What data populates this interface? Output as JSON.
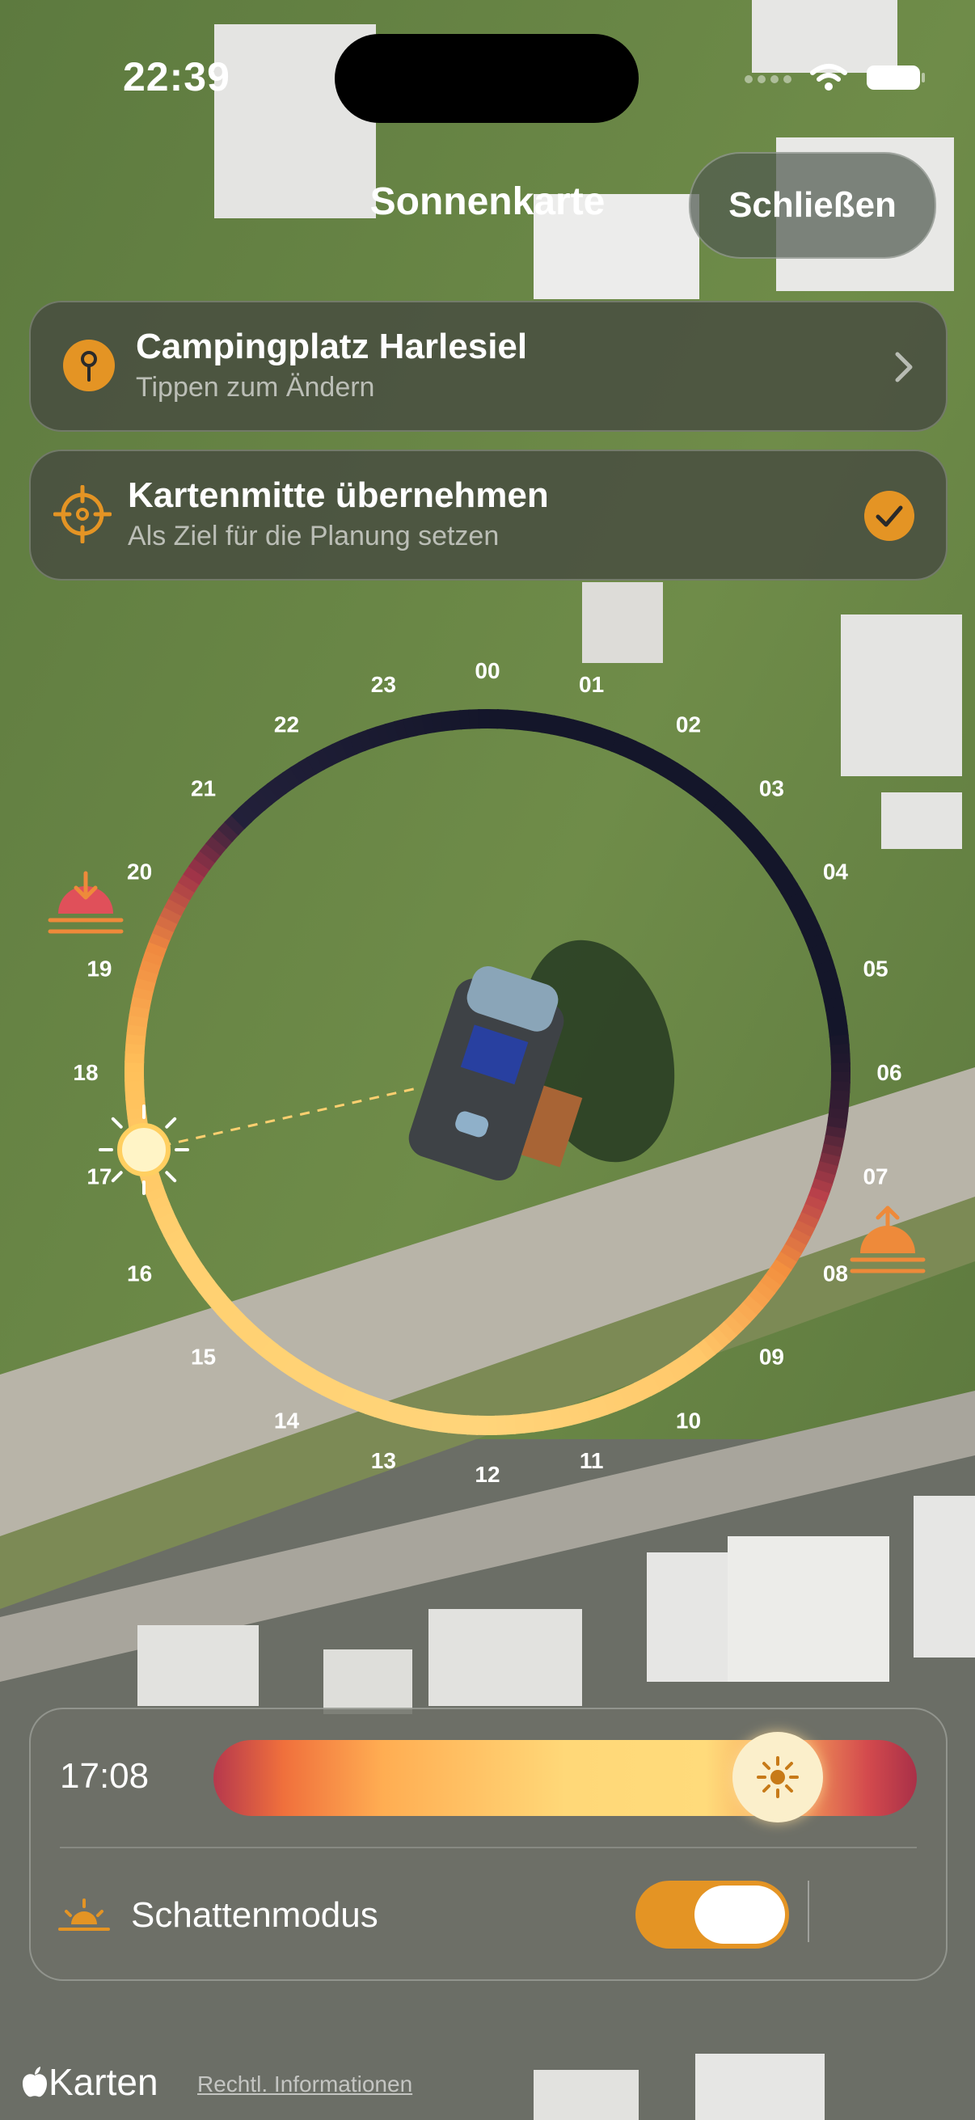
{
  "status_bar": {
    "time": "22:39"
  },
  "header": {
    "title": "Sonnenkarte",
    "close_label": "Schließen"
  },
  "location_card": {
    "title": "Campingplatz Harlesiel",
    "subtitle": "Tippen zum Ändern"
  },
  "map_center_card": {
    "title": "Kartenmitte übernehmen",
    "subtitle": "Als Ziel für die Planung setzen",
    "checked": true
  },
  "sun_dial": {
    "hours": [
      "00",
      "01",
      "02",
      "03",
      "04",
      "05",
      "06",
      "07",
      "08",
      "09",
      "10",
      "11",
      "12",
      "13",
      "14",
      "15",
      "16",
      "17",
      "18",
      "19",
      "20",
      "21",
      "22",
      "23"
    ],
    "current_time": "17:08"
  },
  "controls": {
    "time": "17:08",
    "time_slider_value": 0.8,
    "shadow_mode_label": "Schattenmodus",
    "shadow_mode_on": true
  },
  "footer": {
    "maps_brand": "Karten",
    "legal_link": "Rechtl. Informationen"
  },
  "colors": {
    "accent": "#e49424",
    "sun": "#ffd070",
    "night": "#14162a"
  }
}
